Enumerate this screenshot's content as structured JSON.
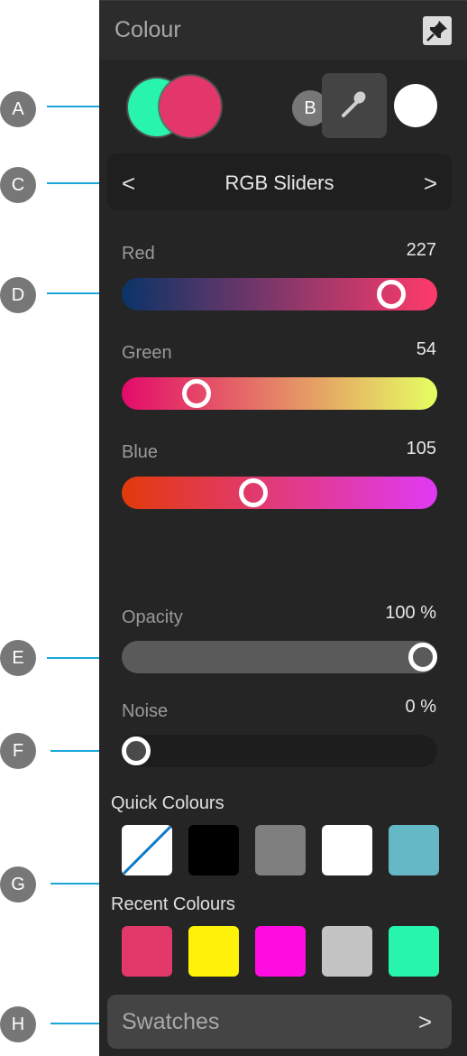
{
  "panel": {
    "title": "Colour",
    "pin_icon": "pin-icon"
  },
  "colour_wells": {
    "secondary": "#28f5ab",
    "primary": "#e3366a",
    "eyedropper_icon": "eyedropper-icon",
    "picked_colour": "#ffffff"
  },
  "mode_selector": {
    "label": "RGB Sliders",
    "prev": "<",
    "next": ">"
  },
  "sliders": [
    {
      "label": "Red",
      "value": "227",
      "fraction": 0.89,
      "gradient": [
        "#0a3468",
        "#ff3a6b"
      ]
    },
    {
      "label": "Green",
      "value": "54",
      "fraction": 0.21,
      "gradient": [
        "#e40a6a",
        "#e6ff62"
      ]
    },
    {
      "label": "Blue",
      "value": "105",
      "fraction": 0.41,
      "gradient": [
        "#e23a0a",
        "#e03af5"
      ]
    }
  ],
  "opacity": {
    "label": "Opacity",
    "value": "100 %",
    "fraction": 1.0
  },
  "noise": {
    "label": "Noise",
    "value": "0 %",
    "fraction": 0.0
  },
  "quick_colours": {
    "title": "Quick Colours",
    "items": [
      {
        "name": "none",
        "color": "#ffffff"
      },
      {
        "name": "black",
        "color": "#000000"
      },
      {
        "name": "grey",
        "color": "#7f7f7f"
      },
      {
        "name": "white",
        "color": "#ffffff"
      },
      {
        "name": "teal",
        "color": "#65b8c6"
      }
    ]
  },
  "recent_colours": {
    "title": "Recent Colours",
    "items": [
      {
        "name": "pink",
        "color": "#e3386a"
      },
      {
        "name": "yellow",
        "color": "#fff20a"
      },
      {
        "name": "magenta",
        "color": "#ff0ce0"
      },
      {
        "name": "light-grey",
        "color": "#c4c4c4"
      },
      {
        "name": "mint",
        "color": "#26f5ab"
      }
    ]
  },
  "swatches": {
    "label": "Swatches",
    "chevron": ">"
  },
  "callouts": [
    "A",
    "B",
    "C",
    "D",
    "E",
    "F",
    "G",
    "H"
  ],
  "accent": "#1aa6d9"
}
